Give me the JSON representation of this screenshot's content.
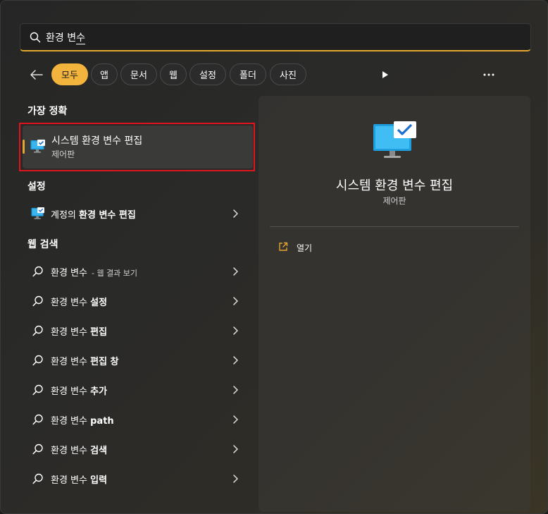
{
  "search": {
    "query_main": "환경 변",
    "query_last": "수"
  },
  "filters": {
    "chips": [
      {
        "label": "모두",
        "active": true
      },
      {
        "label": "앱"
      },
      {
        "label": "문서"
      },
      {
        "label": "웹"
      },
      {
        "label": "설정"
      },
      {
        "label": "폴더"
      },
      {
        "label": "사진"
      }
    ]
  },
  "sections": {
    "best_match": "가장 정확",
    "settings": "설정",
    "web": "웹 검색"
  },
  "best_match": {
    "title": "시스템 환경 변수 편집",
    "subtitle": "제어판"
  },
  "settings_items": [
    {
      "prefix": "계정의 ",
      "bold": "환경 변수 편집"
    }
  ],
  "web_items": [
    {
      "label": "환경 변수",
      "suffix": "- 웹 결과 보기"
    },
    {
      "label": "환경 변수 ",
      "bold": "설정"
    },
    {
      "label": "환경 변수 ",
      "bold": "편집"
    },
    {
      "label": "환경 변수 ",
      "bold": "편집 창"
    },
    {
      "label": "환경 변수 ",
      "bold": "추가"
    },
    {
      "label": "환경 변수 ",
      "bold": "path"
    },
    {
      "label": "환경 변수 ",
      "bold": "검색"
    },
    {
      "label": "환경 변수 ",
      "bold": "입력"
    }
  ],
  "preview": {
    "title": "시스템 환경 변수 편집",
    "subtitle": "제어판",
    "actions": [
      {
        "label": "열기",
        "icon": "open-external-icon"
      }
    ]
  },
  "colors": {
    "accent": "#f2b43c",
    "highlight_box": "#e0141e"
  }
}
